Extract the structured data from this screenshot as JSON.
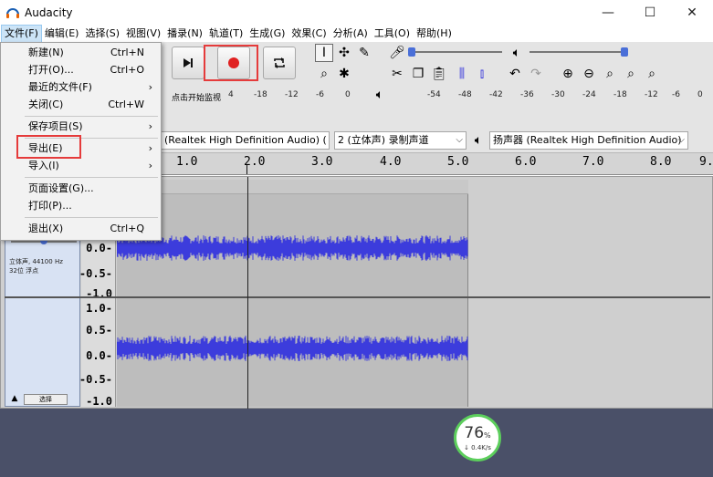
{
  "window": {
    "title": "Audacity",
    "minimize": "—",
    "maximize": "☐",
    "close": "✕"
  },
  "menubar": [
    {
      "label": "文件(F)"
    },
    {
      "label": "编辑(E)"
    },
    {
      "label": "选择(S)"
    },
    {
      "label": "视图(V)"
    },
    {
      "label": "播录(N)"
    },
    {
      "label": "轨道(T)"
    },
    {
      "label": "生成(G)"
    },
    {
      "label": "效果(C)"
    },
    {
      "label": "分析(A)"
    },
    {
      "label": "工具(O)"
    },
    {
      "label": "帮助(H)"
    }
  ],
  "file_menu": {
    "new": {
      "label": "新建(N)",
      "shortcut": "Ctrl+N"
    },
    "open": {
      "label": "打开(O)...",
      "shortcut": "Ctrl+O"
    },
    "recent": {
      "label": "最近的文件(F)",
      "submenu": "›"
    },
    "close": {
      "label": "关闭(C)",
      "shortcut": "Ctrl+W"
    },
    "save_project": {
      "label": "保存项目(S)",
      "submenu": "›"
    },
    "export": {
      "label": "导出(E)",
      "submenu": "›"
    },
    "import": {
      "label": "导入(I)",
      "submenu": "›"
    },
    "page_setup": {
      "label": "页面设置(G)..."
    },
    "print": {
      "label": "打印(P)..."
    },
    "exit": {
      "label": "退出(X)",
      "shortcut": "Ctrl+Q"
    }
  },
  "meter": {
    "hint": "点击开始监视",
    "record_ticks": [
      "4",
      "-18",
      "-12",
      "-6",
      "0"
    ],
    "playback_ticks": [
      "-54",
      "-48",
      "-42",
      "-36",
      "-30",
      "-24",
      "-18",
      "-12",
      "-6",
      "0"
    ]
  },
  "devices": {
    "recording": "(Realtek High Definition Audio) (",
    "channels": "2 (立体声) 录制声道",
    "playback": "扬声器 (Realtek High Definition Audio)"
  },
  "timeline": {
    "ticks": [
      "1.0",
      "2.0",
      "3.0",
      "4.0",
      "5.0",
      "6.0",
      "7.0",
      "8.0",
      "9."
    ]
  },
  "track": {
    "info_line1": "立体声, 44100 Hz",
    "info_line2": "32位 浮点",
    "select_label": "选择",
    "scale_top": [
      "0.0-",
      "-0.5-",
      "-1.0"
    ],
    "scale_bottom": [
      "1.0-",
      "0.5-",
      "0.0-",
      "-0.5-",
      "-1.0"
    ]
  },
  "speed": {
    "percent": "76",
    "percent_sign": "%",
    "rate": "↓ 0.4K/s"
  },
  "colors": {
    "waveform": "#3c3cdc",
    "record_red": "#e02020",
    "highlight": "#e53b3b",
    "progress_ring": "#5cce5c"
  }
}
